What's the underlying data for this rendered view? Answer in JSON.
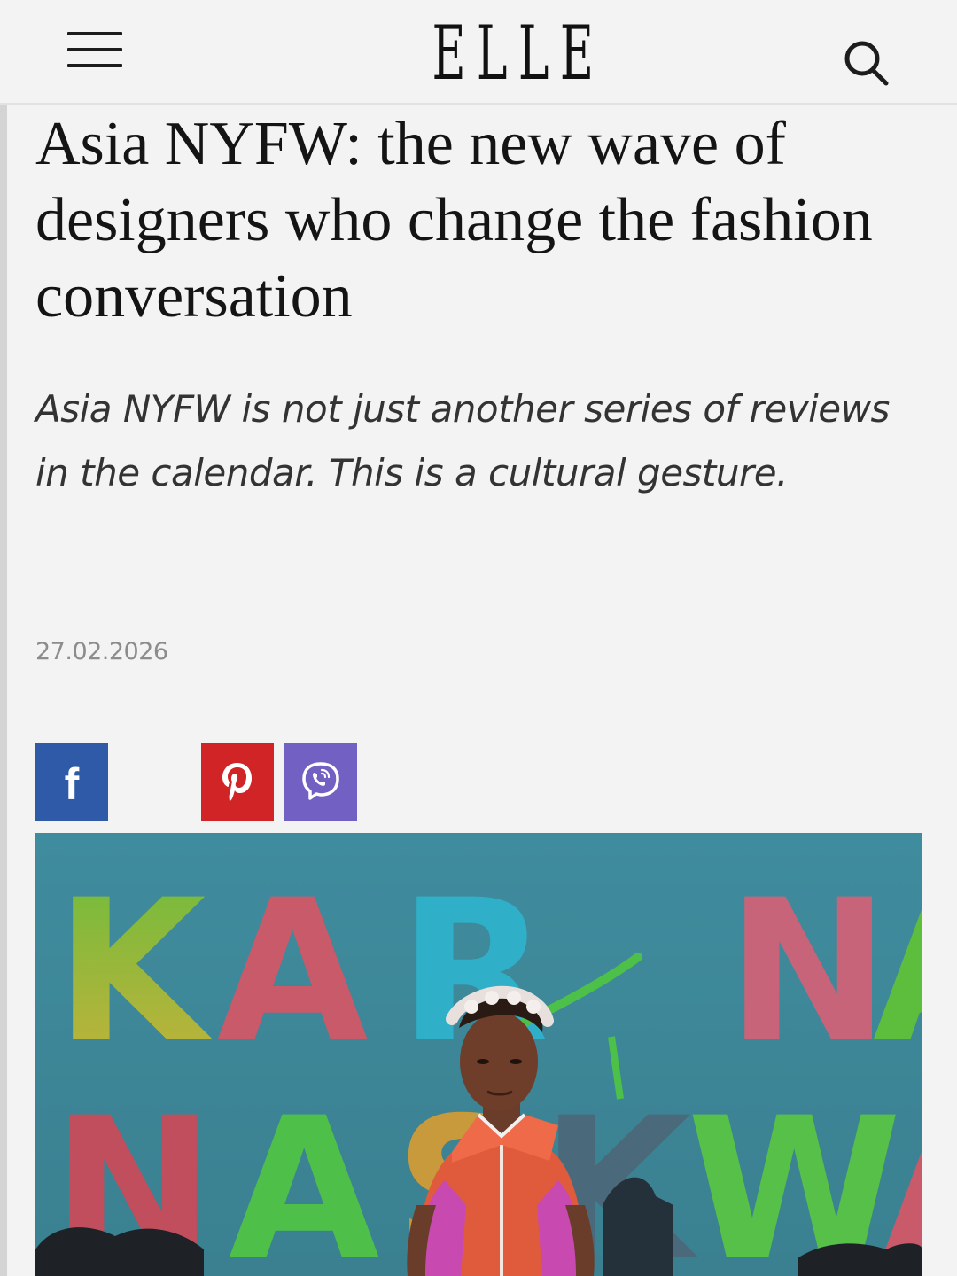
{
  "header": {
    "logo": "ELLE",
    "menu_icon": "hamburger-menu-icon",
    "search_icon": "search-icon"
  },
  "article": {
    "title": "Asia NYFW: the new wave of designers who change the fashion conversation",
    "dek": "Asia NYFW is not just another series of reviews in the calendar. This is a cultural gesture.",
    "date": "27.02.2026"
  },
  "share": {
    "buttons": [
      {
        "network": "facebook",
        "icon": "facebook-icon",
        "color": "#2f5aa8"
      },
      {
        "network": "pinterest",
        "icon": "pinterest-icon",
        "color": "#d02427"
      },
      {
        "network": "viber",
        "icon": "viber-icon",
        "color": "#7360c3"
      }
    ]
  },
  "hero_image": {
    "backdrop_letters_row1": [
      "K",
      "A",
      "R",
      "N",
      "A"
    ],
    "backdrop_letters_row2": [
      "N",
      "A",
      "S",
      "K",
      "W",
      "A"
    ],
    "backdrop_color": "#3e8a9b"
  }
}
